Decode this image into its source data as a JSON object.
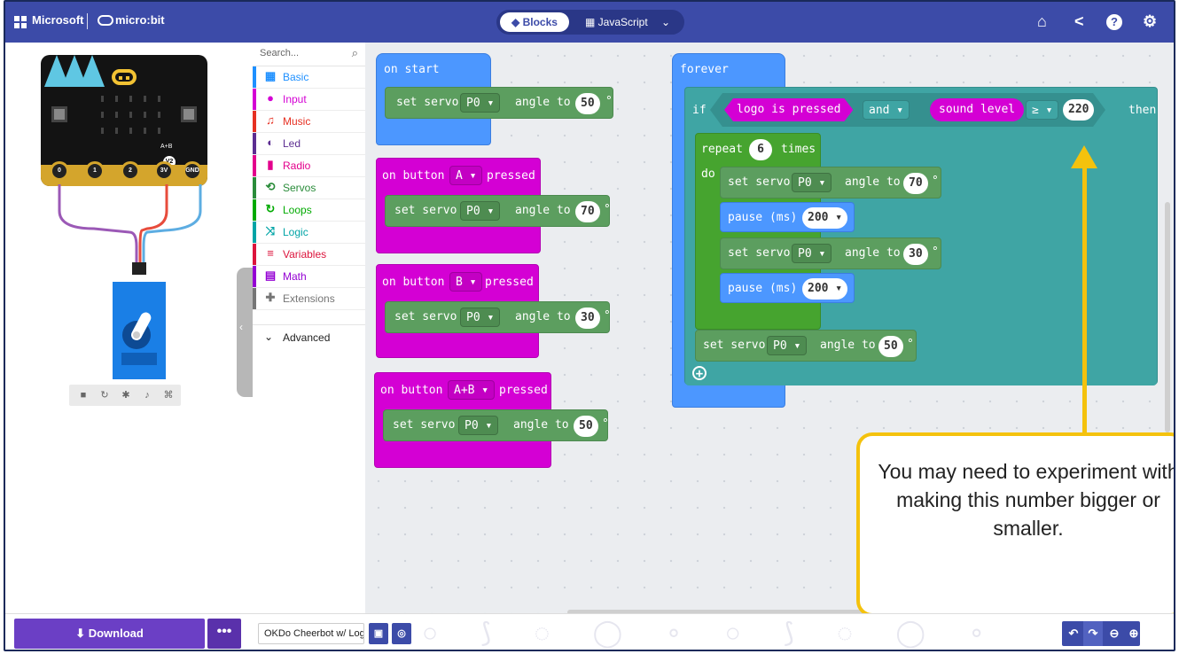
{
  "header": {
    "brand": "Microsoft",
    "product": "micro:bit",
    "mode_blocks": "Blocks",
    "mode_javascript": "JavaScript",
    "icons": [
      "home-icon",
      "share-icon",
      "help-icon",
      "settings-icon"
    ]
  },
  "simulator": {
    "pins": [
      "0",
      "1",
      "2",
      "3V",
      "GND"
    ],
    "label_ab": "A+B",
    "label_v2": "V2",
    "tools": [
      "stop-icon",
      "restart-icon",
      "slowmo-icon",
      "sound-icon",
      "fullscreen-icon"
    ]
  },
  "toolbox": {
    "search_placeholder": "Search...",
    "categories": [
      {
        "label": "Basic",
        "color": "#1e90ff",
        "icon": "grid-icon"
      },
      {
        "label": "Input",
        "color": "#d400d4",
        "icon": "input-icon"
      },
      {
        "label": "Music",
        "color": "#e63022",
        "icon": "headphones-icon"
      },
      {
        "label": "Led",
        "color": "#5c2d91",
        "icon": "toggle-icon"
      },
      {
        "label": "Radio",
        "color": "#e3008c",
        "icon": "signal-icon"
      },
      {
        "label": "Servos",
        "color": "#2a8c3a",
        "icon": "servo-icon"
      },
      {
        "label": "Loops",
        "color": "#00aa00",
        "icon": "loop-icon"
      },
      {
        "label": "Logic",
        "color": "#00a4a6",
        "icon": "shuffle-icon"
      },
      {
        "label": "Variables",
        "color": "#dc143c",
        "icon": "list-icon"
      },
      {
        "label": "Math",
        "color": "#9400d3",
        "icon": "calculator-icon"
      },
      {
        "label": "Extensions",
        "color": "#757575",
        "icon": "plus-icon"
      }
    ],
    "advanced": "Advanced"
  },
  "blocks": {
    "on_start": {
      "hat": "on start",
      "stmt": "set servo",
      "pin": "P0",
      "angle_to": "angle to",
      "value": "50",
      "deg": "°"
    },
    "btn_a": {
      "on": "on button",
      "button": "A",
      "pressed": "pressed",
      "stmt": "set servo",
      "pin": "P0",
      "angle_to": "angle to",
      "value": "70",
      "deg": "°"
    },
    "btn_b": {
      "on": "on button",
      "button": "B",
      "pressed": "pressed",
      "stmt": "set servo",
      "pin": "P0",
      "angle_to": "angle to",
      "value": "30",
      "deg": "°"
    },
    "btn_ab": {
      "on": "on button",
      "button": "A+B",
      "pressed": "pressed",
      "stmt": "set servo",
      "pin": "P0",
      "angle_to": "angle to",
      "value": "50",
      "deg": "°"
    },
    "forever": {
      "hat": "forever",
      "if": "if",
      "cond_left": "logo is pressed",
      "op": "and",
      "sensor": "sound level",
      "cmp": "≥",
      "threshold": "220",
      "then": "then",
      "repeat": "repeat",
      "times_value": "6",
      "times": "times",
      "do": "do",
      "s1": {
        "stmt": "set servo",
        "pin": "P0",
        "angle_to": "angle to",
        "value": "70",
        "deg": "°"
      },
      "p1": {
        "stmt": "pause (ms)",
        "value": "200"
      },
      "s2": {
        "stmt": "set servo",
        "pin": "P0",
        "angle_to": "angle to",
        "value": "30",
        "deg": "°"
      },
      "p2": {
        "stmt": "pause (ms)",
        "value": "200"
      },
      "s3": {
        "stmt": "set servo",
        "pin": "P0",
        "angle_to": "angle to",
        "value": "50",
        "deg": "°"
      }
    }
  },
  "callout": {
    "text": "You may need to experiment with making this number bigger or smaller."
  },
  "footer": {
    "download": "Download",
    "more": "•••",
    "project_name": "OKDo Cheerbot w/ Logo"
  }
}
